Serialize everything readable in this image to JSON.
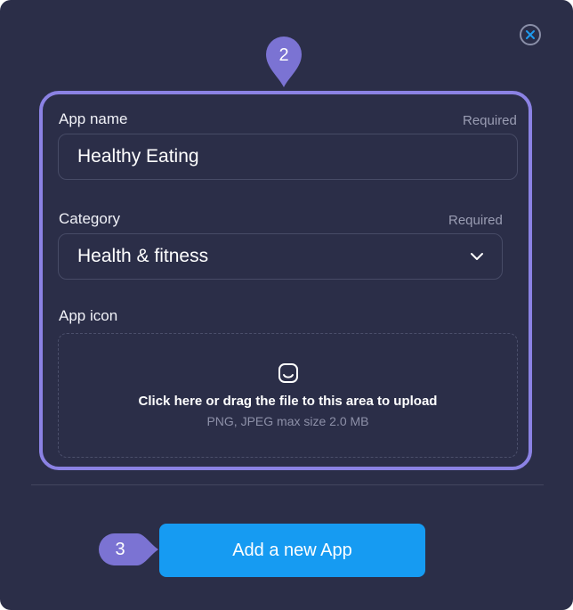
{
  "form": {
    "app_name": {
      "label": "App name",
      "required_label": "Required",
      "value": "Healthy Eating"
    },
    "category": {
      "label": "Category",
      "required_label": "Required",
      "selected": "Health & fitness"
    },
    "app_icon": {
      "label": "App icon",
      "upload_text": "Click here or drag the file to this area to upload",
      "upload_hint": "PNG, JPEG max size 2.0 MB"
    }
  },
  "markers": {
    "step_2": "2",
    "step_3": "3"
  },
  "actions": {
    "submit_label": "Add a new App"
  },
  "icons": {
    "close": "close-icon",
    "chevron": "chevron-down-icon",
    "upload": "image-upload-icon"
  },
  "colors": {
    "background": "#2b2e48",
    "highlight": "#8b82e4",
    "marker": "#7b73d3",
    "primary": "#169bf2",
    "close_accent": "#1e9bf0"
  }
}
